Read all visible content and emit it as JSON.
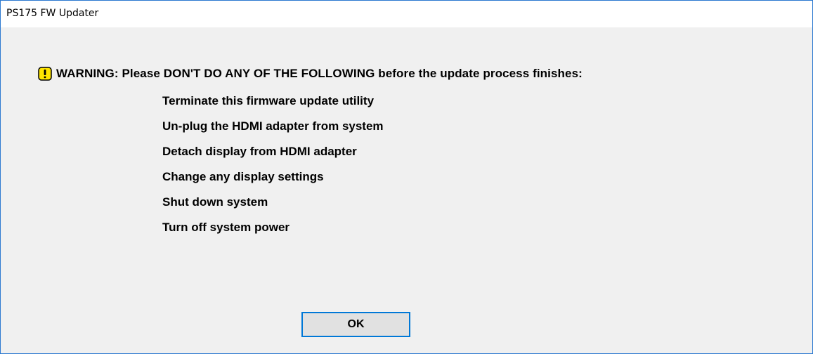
{
  "window": {
    "title": "PS175 FW Updater"
  },
  "dialog": {
    "warning_icon": "warning-icon",
    "warning_text": "WARNING:  Please DON'T DO ANY OF THE FOLLOWING before the update process finishes:",
    "items": [
      "Terminate this firmware update utility",
      "Un-plug the HDMI adapter from system",
      "Detach display from HDMI adapter",
      "Change any display settings",
      "Shut down system",
      "Turn off system power"
    ],
    "ok_label": "OK"
  },
  "colors": {
    "window_border": "#2b79d0",
    "client_background": "#f0f0f0",
    "button_focus_border": "#0078d7",
    "warning_icon_fill": "#ffe500"
  }
}
